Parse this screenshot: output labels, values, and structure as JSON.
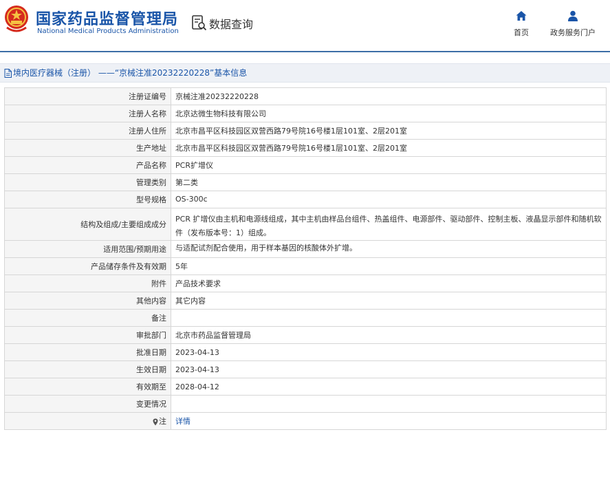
{
  "header": {
    "site_name_cn": "国家药品监督管理局",
    "site_name_en": "National Medical Products Administration",
    "query_title": "数据查询",
    "nav": [
      {
        "label": "首页",
        "icon": "home-icon"
      },
      {
        "label": "政务服务门户",
        "icon": "user-icon"
      }
    ]
  },
  "breadcrumb": {
    "text": "境内医疗器械（注册） ——“京械注准20232220228”基本信息",
    "icon": "document-icon"
  },
  "colors": {
    "brand_blue": "#1a55a8",
    "rule_blue": "#3c6ea6",
    "label_bg": "#f5f5f5",
    "breadcrumb_bg": "#eef1f6"
  },
  "record": {
    "rows": [
      {
        "label": "注册证编号",
        "value": "京械注准20232220228"
      },
      {
        "label": "注册人名称",
        "value": "北京达微生物科技有限公司"
      },
      {
        "label": "注册人住所",
        "value": "北京市昌平区科技园区双营西路79号院16号楼1层101室、2层201室"
      },
      {
        "label": "生产地址",
        "value": "北京市昌平区科技园区双营西路79号院16号楼1层101室、2层201室"
      },
      {
        "label": "产品名称",
        "value": "PCR扩增仪"
      },
      {
        "label": "管理类别",
        "value": "第二类"
      },
      {
        "label": "型号规格",
        "value": "OS-300c"
      },
      {
        "label": "结构及组成/主要组成成分",
        "value": "PCR 扩增仪由主机和电源线组成，其中主机由样品台组件、热盖组件、电源部件、驱动部件、控制主板、液晶显示部件和随机软件（发布版本号：1）组成。"
      },
      {
        "label": "适用范围/预期用途",
        "value": "与适配试剂配合使用，用于样本基因的核酸体外扩增。"
      },
      {
        "label": "产品储存条件及有效期",
        "value": "5年"
      },
      {
        "label": "附件",
        "value": "产品技术要求"
      },
      {
        "label": "其他内容",
        "value": "其它内容"
      },
      {
        "label": "备注",
        "value": ""
      },
      {
        "label": "审批部门",
        "value": "北京市药品监督管理局"
      },
      {
        "label": "批准日期",
        "value": "2023-04-13"
      },
      {
        "label": "生效日期",
        "value": "2023-04-13"
      },
      {
        "label": "有效期至",
        "value": "2028-04-12"
      },
      {
        "label": "变更情况",
        "value": ""
      },
      {
        "label": "注",
        "value": "详情",
        "icon": "pin-icon"
      }
    ]
  }
}
